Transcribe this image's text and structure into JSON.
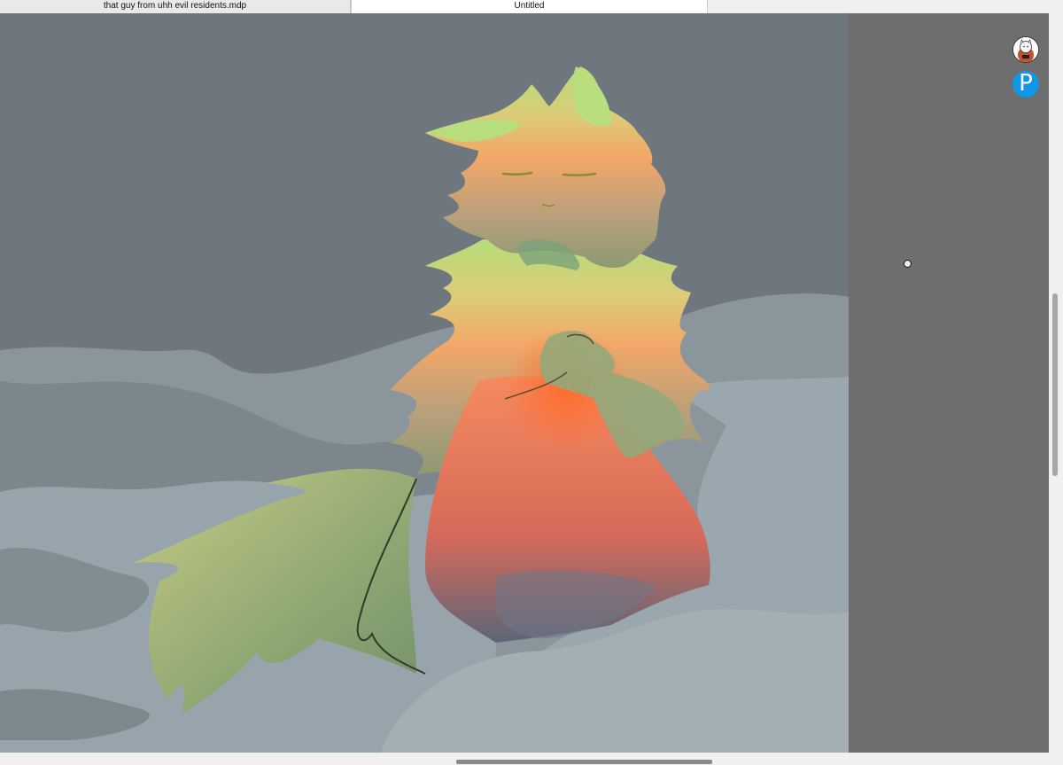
{
  "tabs": [
    {
      "label": "that guy from uhh evil residents.mdp",
      "active": false
    },
    {
      "label": "Untitled",
      "active": true
    }
  ],
  "canvas": {
    "background_color": "#6f777e",
    "cloud_colors": [
      "#8c989f",
      "#9aa6ad"
    ],
    "subject": "fluffy-creature-artwork"
  },
  "right_panel": {
    "background_color": "#6e6e6e",
    "icons": [
      "avatar-icon",
      "pixiv-logo-icon"
    ],
    "pixiv_glyph": "P"
  },
  "scrollbars": {
    "vertical_position": 0.38,
    "horizontal_position": 0.43
  }
}
